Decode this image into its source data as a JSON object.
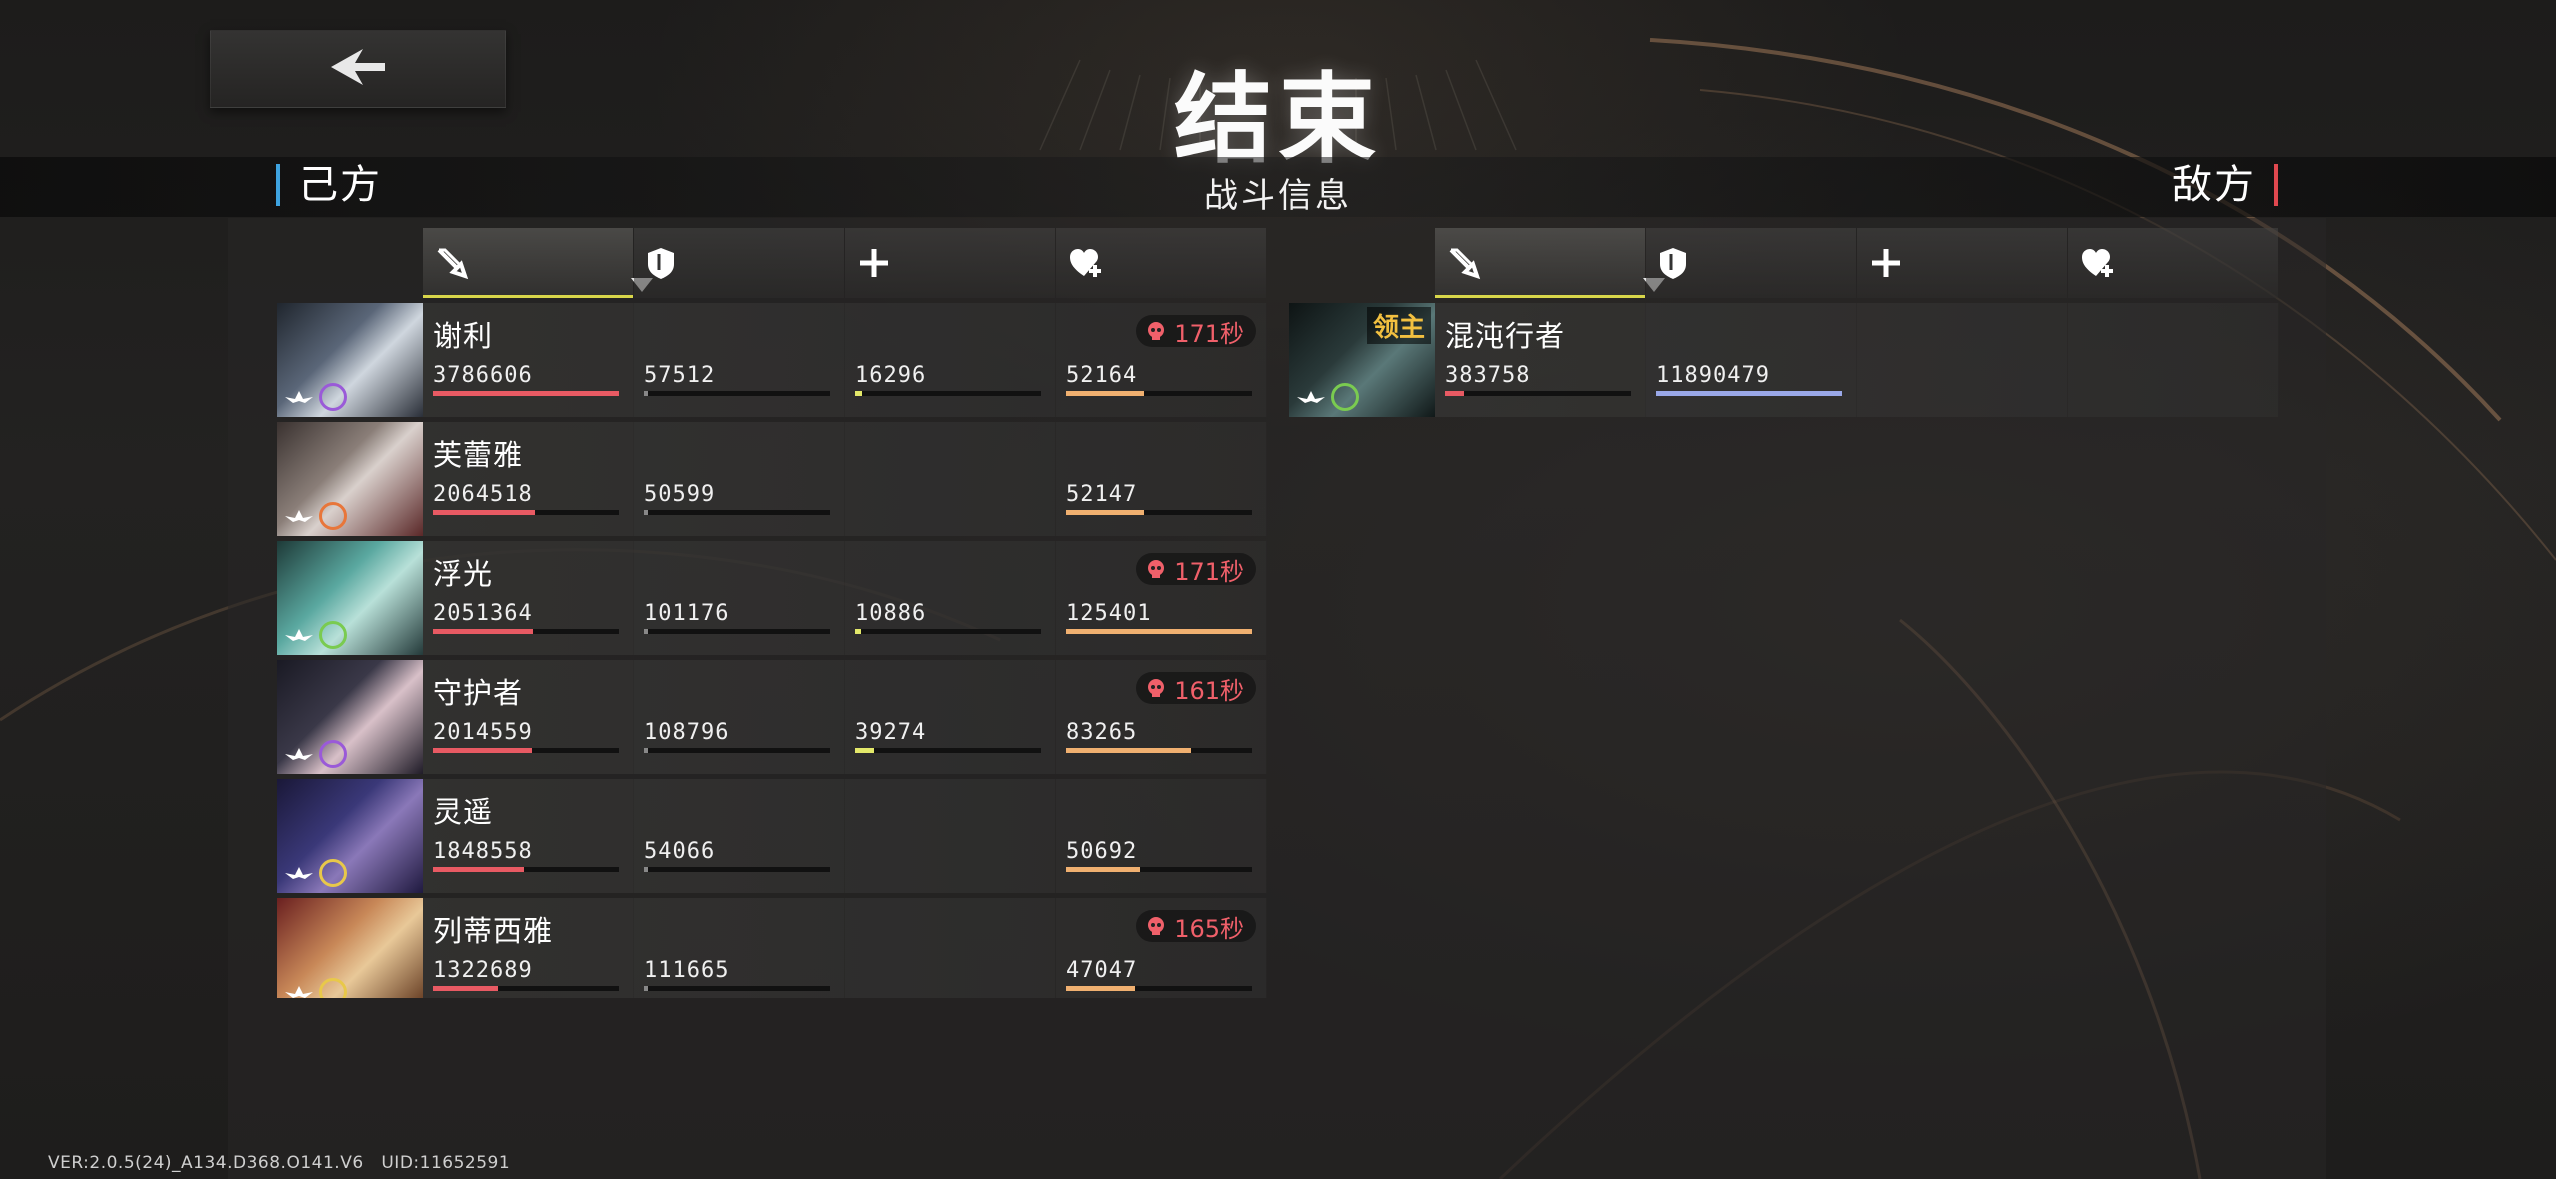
{
  "title": "结束",
  "header": {
    "left_side": "己方",
    "center": "战斗信息",
    "right_side": "敌方"
  },
  "colors": {
    "damage": "#e85a63",
    "taken": "#9aa8e8",
    "heal": "#e3e86a",
    "shield": "#f0b070",
    "death": "#f0606a",
    "active_underline": "#d8d64a",
    "ally_accent": "#3ea3e0",
    "enemy_accent": "#e0484f"
  },
  "columns": [
    {
      "icon": "sword-icon",
      "stat": "damage",
      "sorted": true
    },
    {
      "icon": "shield-icon",
      "stat": "damage-taken"
    },
    {
      "icon": "plus-icon",
      "stat": "healing"
    },
    {
      "icon": "heart-plus-icon",
      "stat": "shield"
    }
  ],
  "allies": [
    {
      "name": "谢利",
      "damage": "3786606",
      "taken": "57512",
      "heal": "16296",
      "shield": "52164",
      "damage_frac": 1.0,
      "taken_frac": 0.02,
      "heal_frac": 0.04,
      "shield_frac": 0.42,
      "death": "171秒",
      "role_icon": "wing-icon",
      "element_icon": "void-element-icon",
      "element_color": "#9a5ad8"
    },
    {
      "name": "芙蕾雅",
      "damage": "2064518",
      "taken": "50599",
      "heal": "",
      "shield": "52147",
      "damage_frac": 0.55,
      "taken_frac": 0.02,
      "heal_frac": 0,
      "shield_frac": 0.42,
      "death": "",
      "role_icon": "wing-icon",
      "element_icon": "fire-element-icon",
      "element_color": "#e8763a"
    },
    {
      "name": "浮光",
      "damage": "2051364",
      "taken": "101176",
      "heal": "10886",
      "shield": "125401",
      "damage_frac": 0.54,
      "taken_frac": 0.02,
      "heal_frac": 0.03,
      "shield_frac": 1.0,
      "death": "171秒",
      "role_icon": "staff-icon",
      "element_icon": "wind-element-icon",
      "element_color": "#7acb50"
    },
    {
      "name": "守护者",
      "damage": "2014559",
      "taken": "108796",
      "heal": "39274",
      "shield": "83265",
      "damage_frac": 0.53,
      "taken_frac": 0.02,
      "heal_frac": 0.1,
      "shield_frac": 0.67,
      "death": "161秒",
      "role_icon": "staff-icon",
      "element_icon": "void-element-icon",
      "element_color": "#9a5ad8"
    },
    {
      "name": "灵遥",
      "damage": "1848558",
      "taken": "54066",
      "heal": "",
      "shield": "50692",
      "damage_frac": 0.49,
      "taken_frac": 0.02,
      "heal_frac": 0,
      "shield_frac": 0.4,
      "death": "",
      "role_icon": "wing-icon",
      "element_icon": "light-element-icon",
      "element_color": "#e8c84a"
    },
    {
      "name": "列蒂西雅",
      "damage": "1322689",
      "taken": "111665",
      "heal": "",
      "shield": "47047",
      "damage_frac": 0.35,
      "taken_frac": 0.02,
      "heal_frac": 0,
      "shield_frac": 0.37,
      "death": "165秒",
      "role_icon": "staff-icon",
      "element_icon": "light-element-icon",
      "element_color": "#e8c84a"
    }
  ],
  "enemies": [
    {
      "name": "混沌行者",
      "tag": "领主",
      "damage": "383758",
      "taken": "11890479",
      "heal": "",
      "shield": "",
      "damage_frac": 0.1,
      "taken_frac": 1.0,
      "role_icon": "wing-icon",
      "element_icon": "wind-element-icon",
      "element_color": "#7acb50"
    }
  ],
  "footer": {
    "version": "VER:2.0.5(24)_A134.D368.O141.V6",
    "uid": "UID:11652591"
  }
}
